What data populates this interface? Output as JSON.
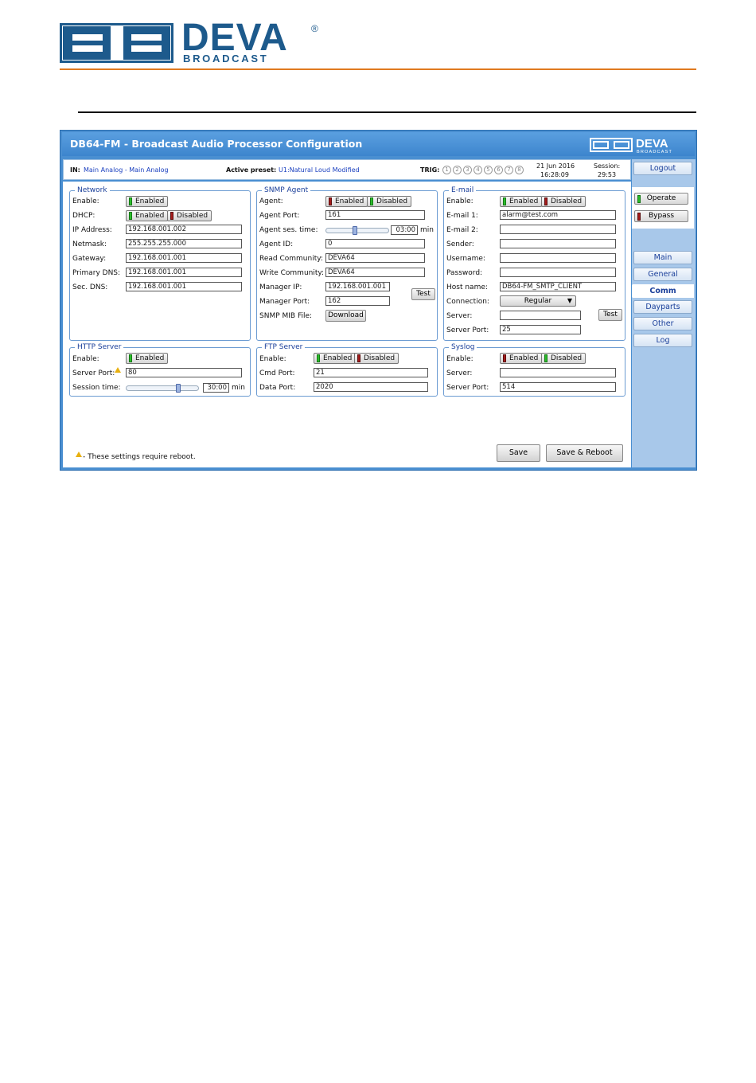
{
  "header": {
    "brand": "DEVA",
    "brand_reg": "®",
    "brand_sub": "BROADCAST"
  },
  "app": {
    "title": "DB64-FM - Broadcast Audio Processor Configuration",
    "mini_brand": "DEVA",
    "mini_brand_sub": "BROADCAST"
  },
  "status": {
    "in_label": "IN:",
    "in_value": "Main Analog - Main Analog",
    "preset_label": "Active preset:",
    "preset_value": "U1:Natural Loud Modified",
    "trig_label": "TRIG:",
    "trig_items": [
      "1",
      "2",
      "3",
      "4",
      "5",
      "6",
      "7",
      "8"
    ],
    "date": "21 Jun 2016",
    "time": "16:28:09",
    "session_label": "Session:",
    "session_value": "29:53"
  },
  "side": {
    "logout": "Logout",
    "operate": "Operate",
    "bypass": "Bypass",
    "nav": [
      "Main",
      "General",
      "Comm",
      "Dayparts",
      "Other",
      "Log"
    ],
    "active": "Comm"
  },
  "network": {
    "legend": "Network",
    "enable_label": "Enable:",
    "enabled": "Enabled",
    "disabled": "Disabled",
    "dhcp_label": "DHCP:",
    "ip_label": "IP Address:",
    "ip": "192.168.001.002",
    "netmask_label": "Netmask:",
    "netmask": "255.255.255.000",
    "gateway_label": "Gateway:",
    "gateway": "192.168.001.001",
    "pdns_label": "Primary DNS:",
    "pdns": "192.168.001.001",
    "sdns_label": "Sec. DNS:",
    "sdns": "192.168.001.001"
  },
  "snmp": {
    "legend": "SNMP Agent",
    "agent_label": "Agent:",
    "enabled": "Enabled",
    "disabled": "Disabled",
    "port_label": "Agent Port:",
    "port": "161",
    "ses_label": "Agent ses. time:",
    "ses_value": "03:00",
    "ses_unit": "min",
    "ses_level": 0.45,
    "id_label": "Agent ID:",
    "id": "0",
    "read_label": "Read Community:",
    "read": "DEVA64",
    "write_label": "Write Community:",
    "write": "DEVA64",
    "mgr_ip_label": "Manager IP:",
    "mgr_ip": "192.168.001.001",
    "mgr_port_label": "Manager Port:",
    "mgr_port": "162",
    "test": "Test",
    "mib_label": "SNMP MIB File:",
    "download": "Download"
  },
  "email": {
    "legend": "E-mail",
    "enable_label": "Enable:",
    "enabled": "Enabled",
    "disabled": "Disabled",
    "email1_label": "E-mail 1:",
    "email1": "alarm@test.com",
    "email2_label": "E-mail 2:",
    "email2": "",
    "sender_label": "Sender:",
    "sender": "",
    "user_label": "Username:",
    "user": "",
    "pass_label": "Password:",
    "pass": "",
    "host_label": "Host name:",
    "host": "DB64-FM_SMTP_CLIENT",
    "conn_label": "Connection:",
    "conn": "Regular",
    "server_label": "Server:",
    "server": "",
    "test": "Test",
    "sport_label": "Server Port:",
    "sport": "25"
  },
  "http": {
    "legend": "HTTP Server",
    "enable_label": "Enable:",
    "enabled": "Enabled",
    "port_label": "Server Port:",
    "port": "80",
    "ses_label": "Session time:",
    "ses_value": "30:00",
    "ses_unit": "min",
    "ses_level": 0.72
  },
  "ftp": {
    "legend": "FTP Server",
    "enable_label": "Enable:",
    "enabled": "Enabled",
    "disabled": "Disabled",
    "cmd_label": "Cmd Port:",
    "cmd": "21",
    "data_label": "Data Port:",
    "data": "2020"
  },
  "syslog": {
    "legend": "Syslog",
    "enable_label": "Enable:",
    "enabled": "Enabled",
    "disabled": "Disabled",
    "server_label": "Server:",
    "server": "",
    "port_label": "Server Port:",
    "port": "514"
  },
  "footer": {
    "note": "- These settings require reboot.",
    "save": "Save",
    "save_reboot": "Save & Reboot"
  }
}
